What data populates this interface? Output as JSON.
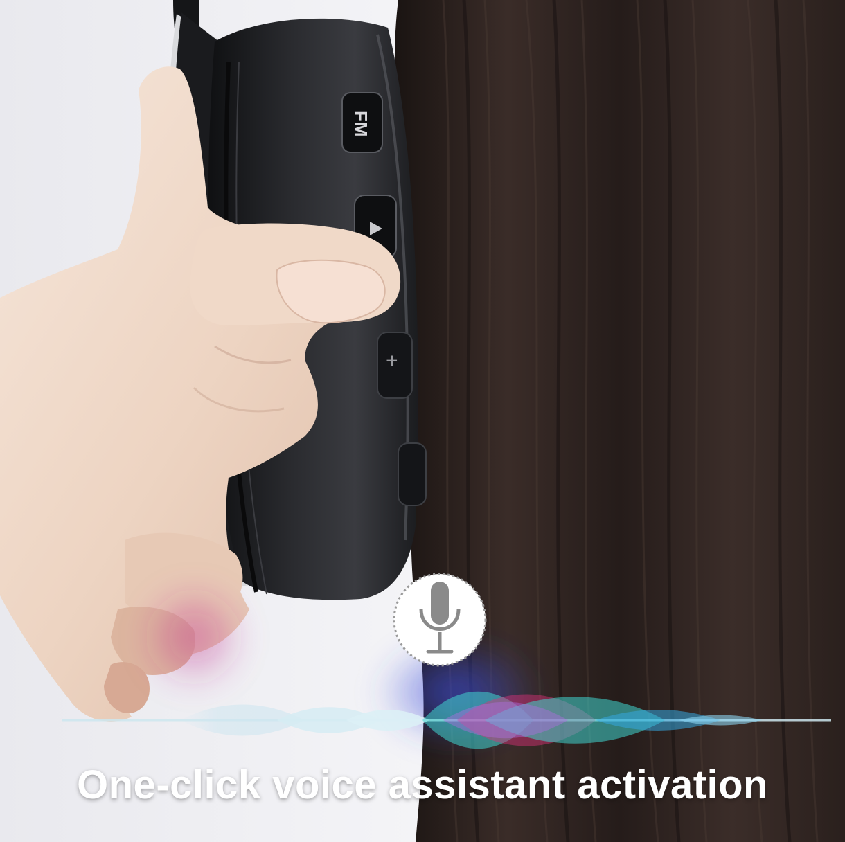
{
  "caption": "One-click voice assistant activation",
  "headphone_buttons": {
    "fm_label": "FM",
    "play_pause_glyph": "▶❚❚",
    "volume_up_glyph": "+"
  },
  "voice_icon": "microphone-icon",
  "colors": {
    "hair": "#2b2220",
    "headphone": "#1e1f22",
    "skin": "#eed8c7",
    "wave_cyan": "#3fd6d0",
    "wave_magenta": "#e0307a",
    "wave_blue": "#3a4bd8",
    "caption": "#ffffff"
  }
}
